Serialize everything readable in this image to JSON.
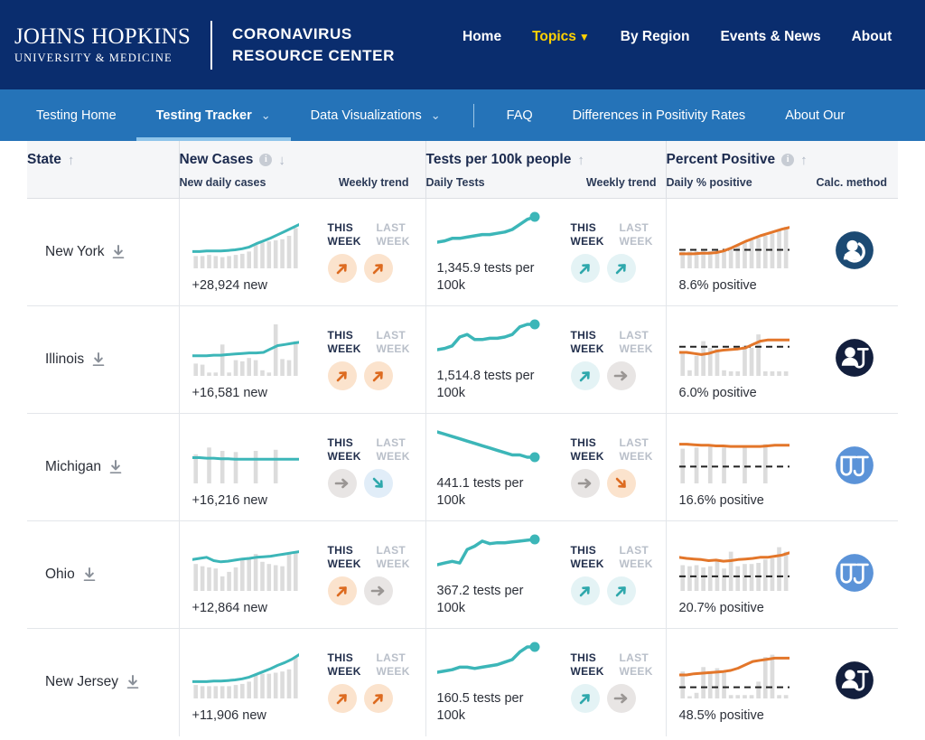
{
  "header": {
    "logo_line1": "JOHNS HOPKINS",
    "logo_line2": "UNIVERSITY & MEDICINE",
    "crc_line1": "CORONAVIRUS",
    "crc_line2": "RESOURCE CENTER",
    "nav": [
      {
        "label": "Home",
        "active": false,
        "caret": false
      },
      {
        "label": "Topics",
        "active": true,
        "caret": true
      },
      {
        "label": "By Region",
        "active": false,
        "caret": false
      },
      {
        "label": "Events & News",
        "active": false,
        "caret": false
      },
      {
        "label": "About",
        "active": false,
        "caret": false
      }
    ],
    "caret_glyph": "▼"
  },
  "subnav": {
    "items": [
      {
        "label": "Testing Home",
        "active": false,
        "chevron": false
      },
      {
        "label": "Testing Tracker",
        "active": true,
        "chevron": true
      },
      {
        "label": "Data Visualizations",
        "active": false,
        "chevron": true
      },
      {
        "label": "FAQ",
        "active": false,
        "chevron": false
      },
      {
        "label": "Differences in Positivity Rates",
        "active": false,
        "chevron": false
      },
      {
        "label": "About Our",
        "active": false,
        "chevron": false
      }
    ],
    "chevron_glyph": "⌄"
  },
  "table": {
    "columns": {
      "state": {
        "title": "State",
        "sort": "↑"
      },
      "new_cases": {
        "title": "New Cases",
        "info": "i",
        "sort": "↓",
        "sub_left": "New daily cases",
        "sub_right": "Weekly trend"
      },
      "tests": {
        "title": "Tests per 100k people",
        "sort": "↑",
        "sub_left": "Daily Tests",
        "sub_right": "Weekly trend"
      },
      "percent_positive": {
        "title": "Percent Positive",
        "info": "i",
        "sort": "↑",
        "sub_left": "Daily % positive",
        "sub_right": "Calc. method"
      }
    },
    "trend_labels": {
      "this_week": "THIS WEEK",
      "last_week": "LAST WEEK"
    },
    "rows": [
      {
        "state": "New York",
        "new_cases_text": "+28,924 new",
        "cases_trend_this": "up-orange",
        "cases_trend_last": "up-orange",
        "tests_text": "1,345.9 tests per 100k",
        "tests_trend_this": "up-teal",
        "tests_trend_last": "up-teal",
        "percent_text": "8.6% positive",
        "calc_method": "person-repeat-icon",
        "calc_color": "#1c4a73"
      },
      {
        "state": "Illinois",
        "new_cases_text": "+16,581 new",
        "cases_trend_this": "up-orange",
        "cases_trend_last": "up-orange",
        "tests_text": "1,514.8 tests per 100k",
        "tests_trend_this": "up-teal",
        "tests_trend_last": "flat-gray",
        "percent_text": "6.0% positive",
        "calc_method": "person-specimen-icon",
        "calc_color": "#131f3d"
      },
      {
        "state": "Michigan",
        "new_cases_text": "+16,216 new",
        "cases_trend_this": "flat-gray",
        "cases_trend_last": "down-teal",
        "tests_text": "441.1 tests per 100k",
        "tests_trend_this": "flat-gray",
        "tests_trend_last": "down-orange",
        "percent_text": "16.6% positive",
        "calc_method": "specimen-icon",
        "calc_color": "#5b93d8"
      },
      {
        "state": "Ohio",
        "new_cases_text": "+12,864 new",
        "cases_trend_this": "up-orange",
        "cases_trend_last": "flat-gray",
        "tests_text": "367.2 tests per 100k",
        "tests_trend_this": "up-teal",
        "tests_trend_last": "up-teal",
        "percent_text": "20.7% positive",
        "calc_method": "specimen-icon",
        "calc_color": "#5b93d8"
      },
      {
        "state": "New Jersey",
        "new_cases_text": "+11,906 new",
        "cases_trend_this": "up-orange",
        "cases_trend_last": "up-orange",
        "tests_text": "160.5 tests per 100k",
        "tests_trend_this": "up-teal",
        "tests_trend_last": "flat-gray",
        "percent_text": "48.5% positive",
        "calc_method": "person-specimen-icon",
        "calc_color": "#131f3d"
      }
    ]
  },
  "colors": {
    "navy": "#0a2d6e",
    "subnav_blue": "#2573b8",
    "accent_yellow": "#ffd100",
    "teal": "#3cb6b8",
    "orange": "#e3762a",
    "bar_gray": "#dcdcdc"
  },
  "chart_data": [
    {
      "type": "bar",
      "title": "New York new daily cases",
      "bars": [
        22,
        22,
        24,
        22,
        20,
        22,
        24,
        26,
        30,
        42,
        46,
        48,
        50,
        52,
        58,
        72
      ],
      "line": [
        30,
        30,
        31,
        31,
        31,
        32,
        33,
        35,
        38,
        44,
        49,
        54,
        60,
        66,
        72,
        78
      ],
      "line_color": "#3cb6b8",
      "bar_color": "#dcdcdc",
      "ylim": [
        0,
        100
      ]
    },
    {
      "type": "line",
      "title": "New York daily tests per 100k",
      "values": [
        30,
        31,
        33,
        33,
        34,
        35,
        36,
        36,
        37,
        38,
        40,
        44,
        48,
        50
      ],
      "line_color": "#3cb6b8",
      "endpoint": true
    },
    {
      "type": "bar",
      "title": "New York daily % positive",
      "bars": [
        30,
        30,
        31,
        31,
        31,
        32,
        33,
        36,
        40,
        46,
        50,
        54,
        58,
        62,
        70,
        74
      ],
      "line": [
        26,
        26,
        26,
        27,
        27,
        28,
        31,
        36,
        42,
        48,
        53,
        58,
        62,
        66,
        70,
        73
      ],
      "threshold": 33,
      "line_color": "#e3762a",
      "bar_color": "#dcdcdc"
    },
    {
      "type": "bar",
      "title": "Illinois new daily cases",
      "bars": [
        22,
        20,
        6,
        6,
        56,
        6,
        28,
        26,
        32,
        28,
        10,
        6,
        92,
        30,
        28,
        62
      ],
      "line": [
        36,
        36,
        36,
        37,
        37,
        38,
        39,
        40,
        41,
        41,
        42,
        48,
        54,
        56,
        58,
        60
      ],
      "line_color": "#3cb6b8",
      "bar_color": "#dcdcdc"
    },
    {
      "type": "line",
      "title": "Illinois daily tests per 100k",
      "values": [
        32,
        33,
        35,
        42,
        44,
        40,
        40,
        41,
        41,
        42,
        44,
        50,
        52,
        52
      ],
      "line_color": "#3cb6b8",
      "endpoint": true
    },
    {
      "type": "bar",
      "title": "Illinois daily % positive",
      "bars": [
        44,
        10,
        36,
        62,
        50,
        48,
        10,
        8,
        8,
        54,
        50,
        74,
        8,
        8,
        8,
        8
      ],
      "line": [
        42,
        42,
        40,
        38,
        40,
        44,
        46,
        47,
        48,
        50,
        56,
        62,
        64,
        64,
        64,
        64
      ],
      "threshold": 52,
      "line_color": "#e3762a",
      "bar_color": "#dcdcdc"
    },
    {
      "type": "bar",
      "title": "Michigan new daily cases",
      "bars": [
        52,
        0,
        64,
        0,
        58,
        0,
        56,
        0,
        0,
        58,
        0,
        0,
        60,
        0,
        0,
        0
      ],
      "line": [
        46,
        46,
        45,
        45,
        44,
        44,
        43,
        43,
        43,
        43,
        43,
        43,
        43,
        43,
        43,
        43
      ],
      "line_color": "#3cb6b8",
      "bar_color": "#dcdcdc"
    },
    {
      "type": "line",
      "title": "Michigan daily tests per 100k",
      "values": [
        54,
        53,
        52,
        51,
        50,
        49,
        48,
        47,
        46,
        45,
        44,
        44,
        43,
        43
      ],
      "line_color": "#3cb6b8",
      "endpoint": true
    },
    {
      "type": "bar",
      "title": "Michigan daily % positive",
      "bars": [
        62,
        0,
        64,
        0,
        66,
        0,
        64,
        0,
        0,
        66,
        0,
        0,
        70,
        0,
        0,
        0
      ],
      "line": [
        70,
        70,
        69,
        68,
        68,
        67,
        67,
        66,
        66,
        66,
        66,
        66,
        67,
        68,
        68,
        68
      ],
      "threshold": 30,
      "line_color": "#e3762a",
      "bar_color": "#dcdcdc"
    },
    {
      "type": "bar",
      "title": "Ohio new daily cases",
      "bars": [
        48,
        44,
        42,
        40,
        26,
        34,
        42,
        56,
        60,
        66,
        52,
        48,
        46,
        44,
        68,
        70
      ],
      "line": [
        56,
        58,
        60,
        54,
        52,
        53,
        55,
        57,
        58,
        60,
        61,
        62,
        64,
        66,
        68,
        70
      ],
      "line_color": "#3cb6b8",
      "bar_color": "#dcdcdc"
    },
    {
      "type": "line",
      "title": "Ohio daily tests per 100k",
      "values": [
        22,
        24,
        26,
        24,
        40,
        44,
        50,
        47,
        48,
        48,
        49,
        50,
        51,
        52
      ],
      "line_color": "#3cb6b8",
      "endpoint": true
    },
    {
      "type": "bar",
      "title": "Ohio daily % positive",
      "bars": [
        46,
        44,
        46,
        42,
        44,
        56,
        40,
        70,
        44,
        48,
        48,
        50,
        56,
        58,
        78,
        70
      ],
      "line": [
        60,
        58,
        57,
        56,
        54,
        55,
        53,
        54,
        56,
        57,
        58,
        60,
        60,
        62,
        64,
        68
      ],
      "threshold": 26,
      "line_color": "#e3762a",
      "bar_color": "#dcdcdc"
    },
    {
      "type": "bar",
      "title": "New Jersey new daily cases",
      "bars": [
        24,
        22,
        22,
        22,
        22,
        22,
        24,
        26,
        30,
        42,
        44,
        44,
        46,
        48,
        52,
        74
      ],
      "line": [
        30,
        30,
        30,
        31,
        31,
        32,
        33,
        35,
        38,
        43,
        48,
        53,
        59,
        64,
        70,
        78
      ],
      "line_color": "#3cb6b8",
      "bar_color": "#dcdcdc"
    },
    {
      "type": "line",
      "title": "New Jersey daily tests per 100k",
      "values": [
        30,
        31,
        32,
        34,
        34,
        33,
        34,
        35,
        36,
        38,
        40,
        46,
        50,
        50
      ],
      "line_color": "#3cb6b8",
      "endpoint": true
    },
    {
      "type": "bar",
      "title": "New Jersey daily % positive",
      "bars": [
        48,
        4,
        10,
        56,
        48,
        54,
        48,
        6,
        6,
        6,
        6,
        30,
        74,
        78,
        6,
        6
      ],
      "line": [
        42,
        42,
        44,
        45,
        46,
        47,
        48,
        50,
        54,
        60,
        66,
        68,
        70,
        72,
        72,
        72
      ],
      "threshold": 20,
      "line_color": "#e3762a",
      "bar_color": "#dcdcdc"
    }
  ]
}
